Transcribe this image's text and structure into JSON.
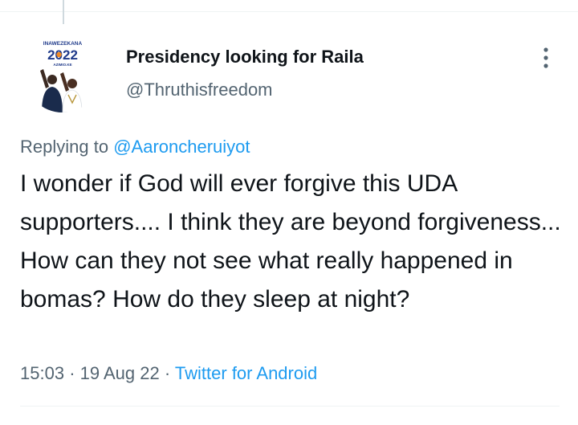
{
  "tweet": {
    "author": {
      "display_name": "Presidency looking for Raila",
      "handle": "@Thruthisfreedom",
      "avatar": {
        "top_text": "INAWEZEKANA",
        "year_text": "2022",
        "site_text": "AZIMIO.KE"
      }
    },
    "reply": {
      "prefix": "Replying to",
      "mention": "@Aaroncheruiyot"
    },
    "text": "I wonder if God will ever forgive this UDA supporters.... I think they are beyond forgiveness... How can they not see what really happened in bomas? How do they sleep at night?",
    "time": "15:03",
    "separator": "·",
    "date": "19 Aug 22",
    "source": "Twitter for Android"
  },
  "icons": {
    "more": "vertical-ellipsis-icon"
  },
  "colors": {
    "accent": "#1d9bf0",
    "secondary_text": "#536471",
    "primary_text": "#0f1419"
  }
}
